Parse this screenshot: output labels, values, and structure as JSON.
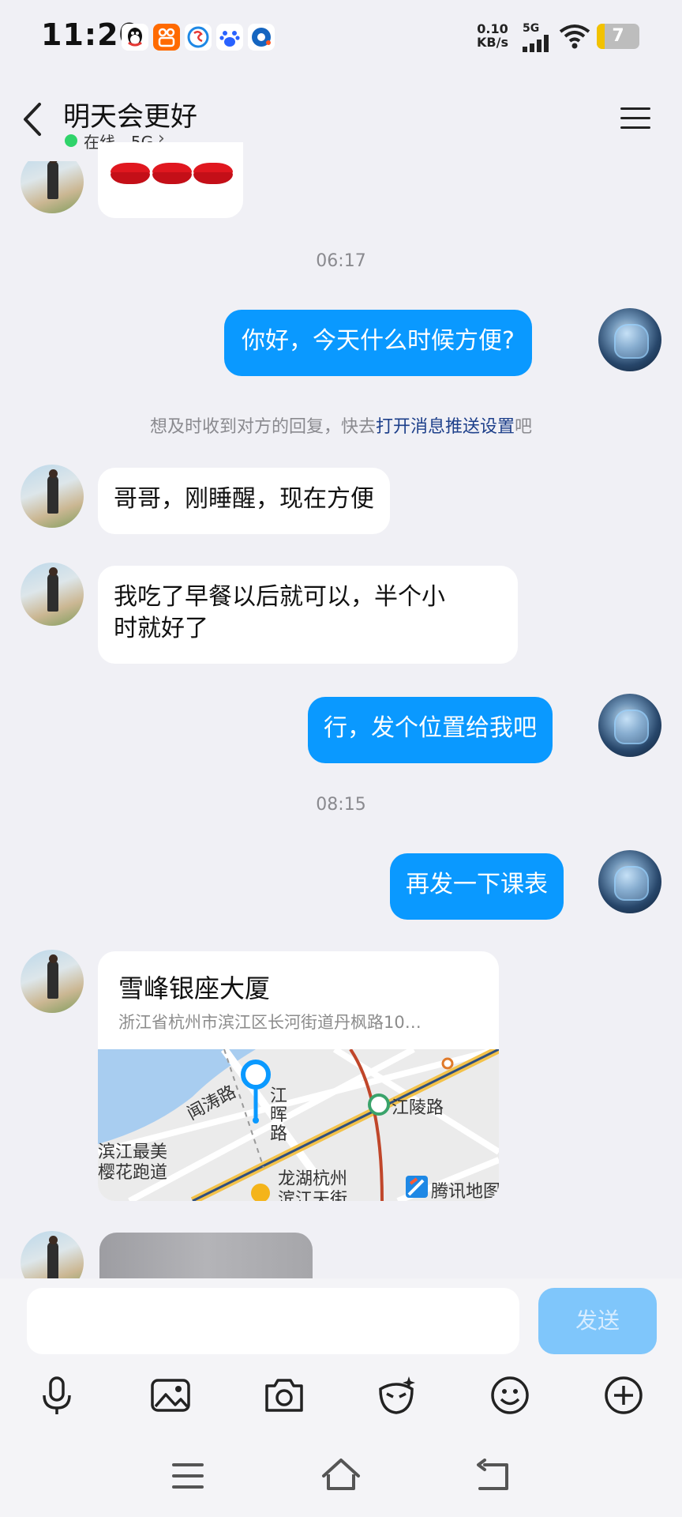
{
  "status_bar": {
    "time": "11:20",
    "net_speed_value": "0.10",
    "net_speed_unit": "KB/s",
    "network": "5G",
    "battery": "7",
    "icons": [
      "qq-icon",
      "kuaishou-icon",
      "sogou-icon",
      "baidu-icon",
      "browser-icon",
      "signal-icon",
      "wifi-icon",
      "battery-icon"
    ]
  },
  "header": {
    "title": "明天会更好",
    "status": "在线 - 5G"
  },
  "messages": {
    "m1_emoji": "👄👄👄",
    "time1": "06:17",
    "m2": "你好，今天什么时候方便?",
    "notice_prefix": "想及时收到对方的回复，快去",
    "notice_link": "打开消息推送设置",
    "notice_suffix": "吧",
    "m3": "哥哥，刚睡醒，现在方便",
    "m4_line1": "我吃了早餐以后就可以，半个小",
    "m4_line2": "时就好了",
    "m5": "行，发个位置给我吧",
    "time2": "08:15",
    "m6": "再发一下课表"
  },
  "location": {
    "title": "雪峰银座大厦",
    "address": "浙江省杭州市滨江区长河街道丹枫路10…",
    "map_labels": {
      "road1": "闻涛路",
      "road2_a": "江",
      "road2_b": "晖",
      "road2_c": "路",
      "station": "江陵路",
      "park_a": "滨江最美",
      "park_b": "樱花跑道",
      "mall_a": "龙湖杭州",
      "mall_b": "滨江天街",
      "provider": "腾讯地图"
    }
  },
  "composer": {
    "placeholder": "",
    "send_label": "发送"
  },
  "colors": {
    "accent": "#0a99ff",
    "send_disabled": "#7fc6fb",
    "online": "#2fd36a",
    "link": "#1d3f8a"
  }
}
